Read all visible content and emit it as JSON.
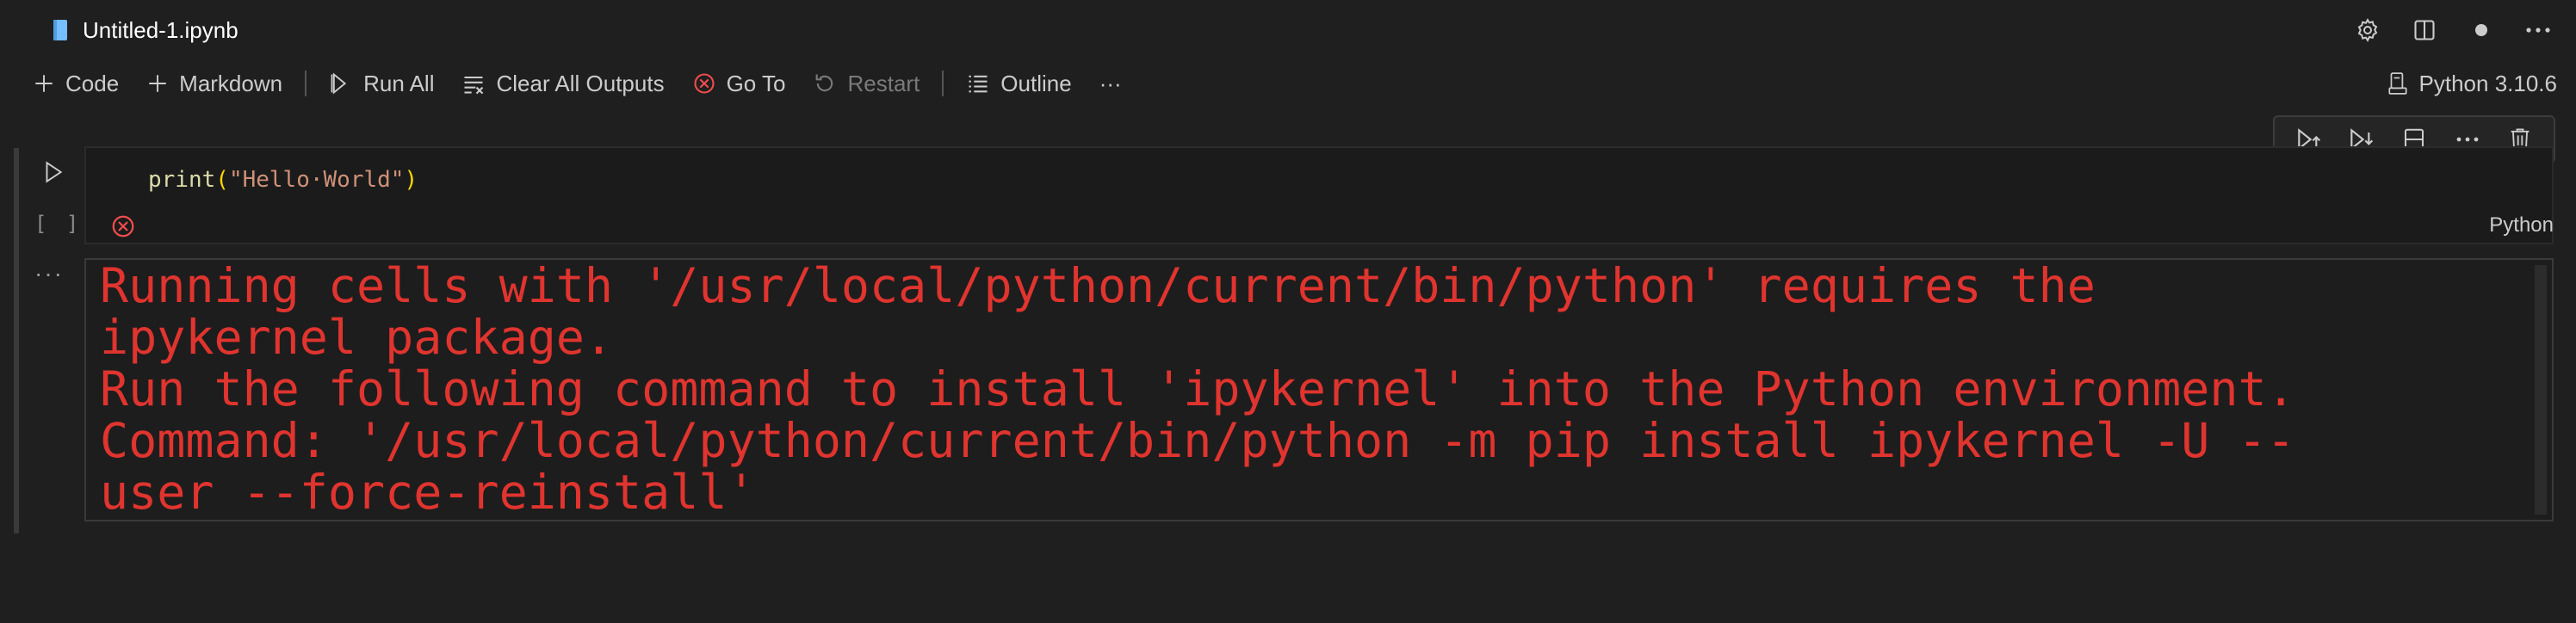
{
  "tab": {
    "title": "Untitled-1.ipynb",
    "icon": "notebook-file-icon"
  },
  "title_actions": [
    {
      "name": "settings-icon"
    },
    {
      "name": "split-editor-icon"
    },
    {
      "name": "unsaved-dot-icon"
    },
    {
      "name": "more-actions-icon"
    }
  ],
  "toolbar": {
    "code_label": "Code",
    "markdown_label": "Markdown",
    "run_all_label": "Run All",
    "clear_outputs_label": "Clear All Outputs",
    "go_to_label": "Go To",
    "restart_label": "Restart",
    "outline_label": "Outline",
    "more_label": "···"
  },
  "kernel": {
    "label": "Python 3.10.6"
  },
  "cell": {
    "exec_count": "[ ]",
    "code": {
      "fn": "print",
      "open": "(",
      "string": "\"Hello·World\"",
      "close": ")"
    },
    "language": "Python",
    "status": "error"
  },
  "output": {
    "more": "···",
    "lines": [
      "Running cells with '/usr/local/python/current/bin/python' requires the",
      "ipykernel package.",
      "Run the following command to install 'ipykernel' into the Python environment.",
      "Command: '/usr/local/python/current/bin/python -m pip install ipykernel -U --",
      "user --force-reinstall'"
    ]
  },
  "colors": {
    "background": "#1f1f1f",
    "error_text": "#e0342f",
    "error_icon": "#f14c4c",
    "notebook_icon": "#75beff"
  }
}
